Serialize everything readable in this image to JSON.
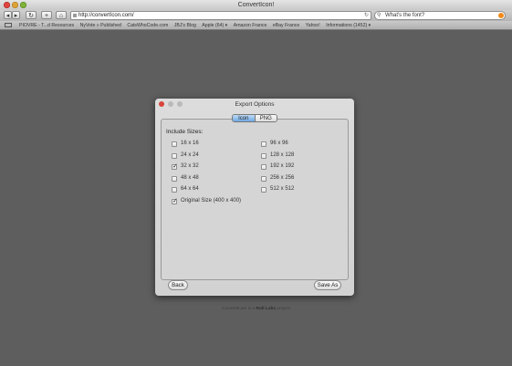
{
  "window": {
    "title": "ConvertIcon!"
  },
  "toolbar": {
    "url": "http://convertIcon.com/",
    "search_value": "What's the font?"
  },
  "bookmarks": [
    "PIOVRE - T...d Resources",
    "NyVote » Published",
    "CatsWhoCode.com",
    "JBJ's Blog",
    "Apple (64) ▾",
    "Amazon France",
    "eBay France",
    "Yahoo!",
    "Informations (1452) ▾"
  ],
  "dialog": {
    "title": "Export Options",
    "tabs": [
      {
        "label": "Icon",
        "active": true
      },
      {
        "label": "PNG",
        "active": false
      }
    ],
    "include_label": "Include Sizes:",
    "sizes_left": [
      {
        "label": "16 x 16",
        "checked": false
      },
      {
        "label": "24 x 24",
        "checked": false
      },
      {
        "label": "32 x 32",
        "checked": true
      },
      {
        "label": "48 x 48",
        "checked": false
      },
      {
        "label": "64 x 64",
        "checked": false
      },
      {
        "label": "Original Size (400 x 400)",
        "checked": true
      }
    ],
    "sizes_right": [
      {
        "label": "96 x 96",
        "checked": false
      },
      {
        "label": "128 x 128",
        "checked": false
      },
      {
        "label": "192 x 192",
        "checked": false
      },
      {
        "label": "256 x 256",
        "checked": false
      },
      {
        "label": "512 x 512",
        "checked": false
      }
    ],
    "back_label": "Back",
    "save_label": "Save As"
  },
  "footer": {
    "prefix": "ConvertIcon! is a ",
    "brand": "Roll Labs",
    "suffix": " project"
  }
}
